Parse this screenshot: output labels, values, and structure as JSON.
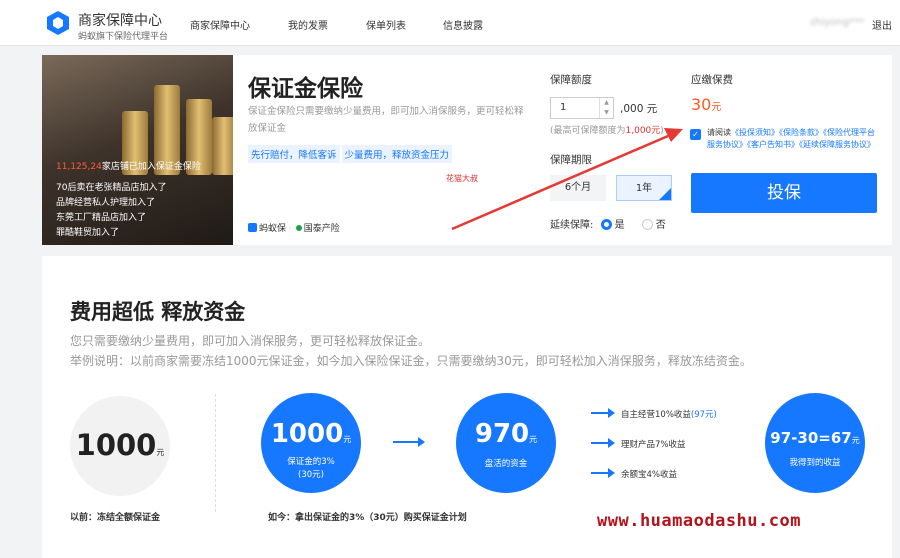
{
  "nav": {
    "brand_title": "商家保障中心",
    "brand_subtitle": "蚂蚁旗下保险代理平台",
    "items": [
      "商家保障中心",
      "我的发票",
      "保单列表",
      "信息披露"
    ],
    "user": "zhiyong***",
    "logout": "退出"
  },
  "banner": {
    "lines": [
      {
        "highlight": "11,125,24",
        "text": "家店铺已加入保证金保险"
      },
      {
        "highlight": "",
        "text": "70后卖在老张精品店加入了"
      },
      {
        "highlight": "",
        "text": "品牌经营私人护理加入了"
      },
      {
        "highlight": "",
        "text": "东莞工厂精品店加入了"
      },
      {
        "highlight": "",
        "text": "罪酷鞋贸加入了"
      }
    ]
  },
  "product": {
    "title": "保证金保险",
    "desc": "保证金保险只需要缴纳少量费用，即可加入消保服务，更可轻松释放保证金",
    "tags": [
      "先行赔付，降低客诉",
      "少量费用，释放资金压力"
    ],
    "watermark": "花猫大叔",
    "partner_a": "蚂蚁保",
    "partner_b": "国泰产险"
  },
  "form": {
    "amount_label": "保障额度",
    "amount_value": "1",
    "amount_unit": ",000 元",
    "amount_hint_prefix": "(最高可保障额度为",
    "amount_hint_max": "1,000元",
    "amount_hint_suffix": ")",
    "period_label": "保障期限",
    "periods": [
      "6个月",
      "1年"
    ],
    "selected_period": "1年",
    "renew_label": "延续保障:",
    "renew_yes": "是",
    "renew_no": "否",
    "renew_selected": "是"
  },
  "fee": {
    "label": "应缴保费",
    "value": "30",
    "unit": "元",
    "agree_prefix": "请阅读",
    "agree_links": [
      "《投保须知》",
      "《保险条款》",
      "《保险代理平台服务协议》",
      "《客户告知书》",
      "《延续保障服务协议》"
    ],
    "buy_button": "投保"
  },
  "info": {
    "title": "费用超低 释放资金",
    "line1": "您只需要缴纳少量费用，即可加入消保服务，更可轻松释放保证金。",
    "line2": "举例说明：以前商家需要冻结1000元保证金，如今加入保险保证金，只需要缴纳30元，即可轻松加入消保服务，释放冻结资金。",
    "before_value": "1000",
    "before_unit": "元",
    "before_caption": "以前：冻结全额保证金",
    "now_value": "1000",
    "now_unit": "元",
    "now_sub1": "保证金的3%",
    "now_sub2": "(30元)",
    "now_caption": "如今：拿出保证金的3%（30元）购买保证金计划",
    "freed_value": "970",
    "freed_unit": "元",
    "freed_sub": "盘活的资金",
    "bullet1_text": "自主经营10%收益",
    "bullet1_highlight": "(97元)",
    "bullet2": "理财产品7%收益",
    "bullet3": "余额宝4%收益",
    "result_value": "97-30=67",
    "result_unit": "元",
    "result_sub": "我得到的收益"
  },
  "site_watermark": "www.huamaodashu.com",
  "colors": {
    "primary": "#1677ff",
    "fee": "#ff5a1f",
    "annotation_arrow": "#e53935"
  }
}
